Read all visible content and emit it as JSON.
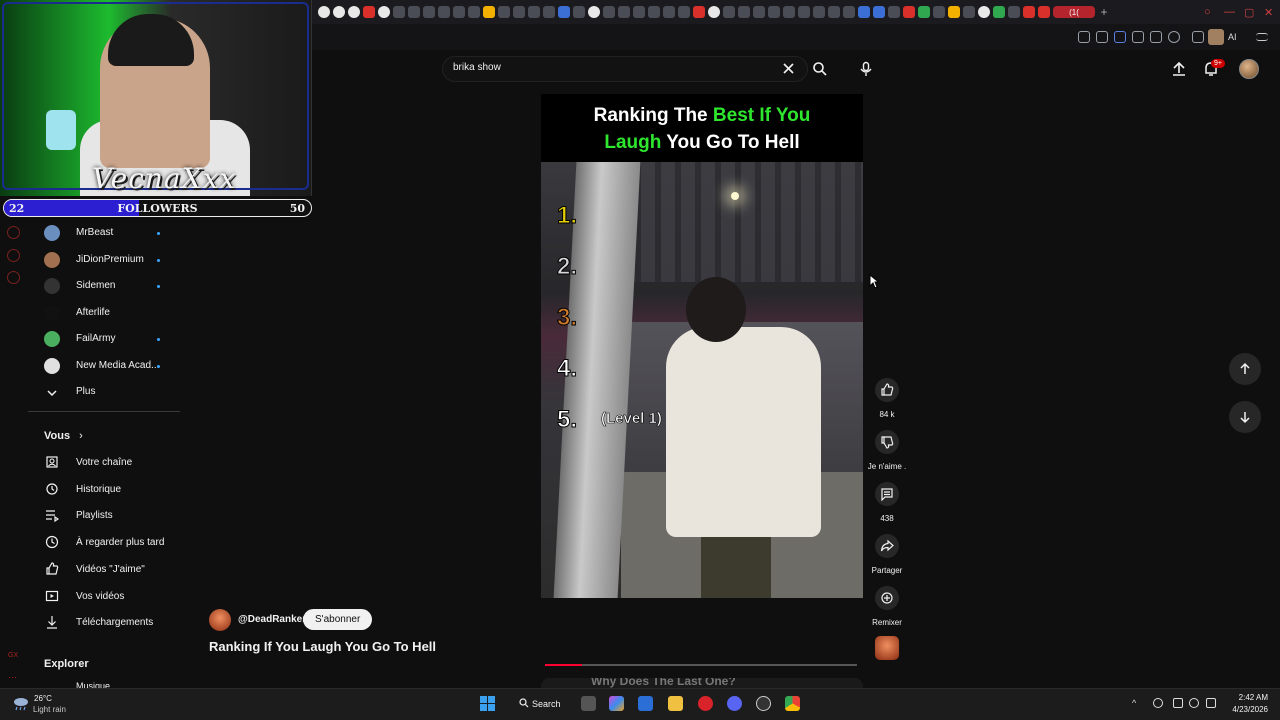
{
  "stream_overlay": {
    "streamer_name": "VecnaXxx",
    "followers": {
      "label": "FOLLOWERS",
      "current": "22",
      "goal": "50",
      "progress_fraction": 0.44
    }
  },
  "browser": {
    "active_tab_label": "(1(",
    "toolbar_ai_label": "AI"
  },
  "search": {
    "query": "brika show"
  },
  "header": {
    "notification_badge": "9+"
  },
  "sidebar": {
    "subscriptions": [
      {
        "label": "MrBeast",
        "color": "#6a8fbf",
        "dot": true
      },
      {
        "label": "JiDionPremium",
        "color": "#a07050",
        "dot": true
      },
      {
        "label": "Sidemen",
        "color": "#333333",
        "dot": true
      },
      {
        "label": "Afterlife",
        "color": "#111111",
        "dot": false
      },
      {
        "label": "FailArmy",
        "color": "#4ab060",
        "dot": true
      },
      {
        "label": "New Media Acad...",
        "color": "#e0e0e0",
        "dot": true
      }
    ],
    "more_label": "Plus",
    "you_section": {
      "title": "Vous",
      "items": [
        {
          "label": "Votre chaîne",
          "icon": "channel-icon"
        },
        {
          "label": "Historique",
          "icon": "history-icon"
        },
        {
          "label": "Playlists",
          "icon": "playlists-icon"
        },
        {
          "label": "À regarder plus tard",
          "icon": "watch-later-icon"
        },
        {
          "label": "Vidéos \"J'aime\"",
          "icon": "liked-icon"
        },
        {
          "label": "Vos vidéos",
          "icon": "your-videos-icon"
        },
        {
          "label": "Téléchargements",
          "icon": "downloads-icon"
        }
      ]
    },
    "explore_section": {
      "title": "Explorer",
      "first_item": "Musique"
    }
  },
  "video": {
    "header_line1_white": "Ranking The",
    "header_line1_green": "Best If You",
    "header_line2_green": "Laugh",
    "header_line2_white": "You Go To Hell",
    "ranks": [
      "1.",
      "2.",
      "3.",
      "4.",
      "5."
    ],
    "rank_colors": [
      "#e8d000",
      "#d8d8d8",
      "#d07a2a",
      "#ffffff",
      "#ffffff"
    ],
    "rank5_label": "(Level 1)",
    "progress_fraction": 0.12,
    "next_preview_text": "Why Does The Last One?"
  },
  "actions": {
    "likes": "84 k",
    "dislike_label": "Je n'aime .",
    "comments": "438",
    "share_label": "Partager",
    "remix_label": "Remixer"
  },
  "channel": {
    "handle": "@DeadRanker",
    "subscribe_label": "S'abonner",
    "video_title": "Ranking If You Laugh You Go To Hell"
  },
  "taskbar": {
    "weather_temp": "26°C",
    "weather_desc": "Light rain",
    "search_label": "Search",
    "time": "2:42 AM",
    "date": "4/23/2026"
  },
  "colors": {
    "accent_red": "#ff0033",
    "green_title": "#2ee62e",
    "link_blue": "#3ea6ff"
  }
}
